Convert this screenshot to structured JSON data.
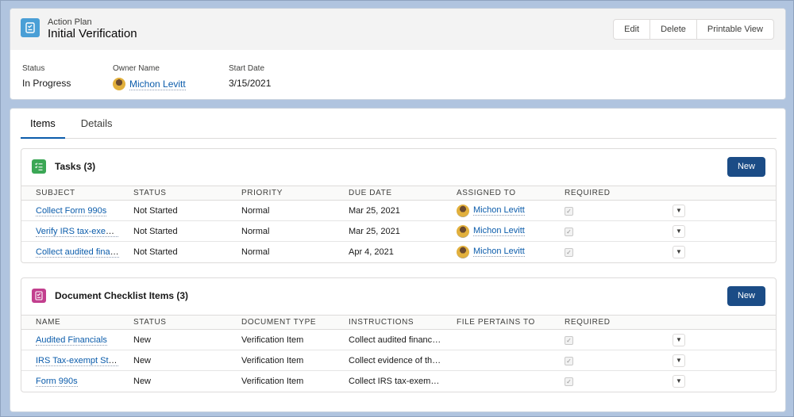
{
  "header": {
    "record_type": "Action Plan",
    "title": "Initial Verification",
    "icon": "action-plan-icon",
    "buttons": [
      "Edit",
      "Delete",
      "Printable View"
    ],
    "fields": {
      "status": {
        "label": "Status",
        "value": "In Progress"
      },
      "owner": {
        "label": "Owner Name",
        "value": "Michon Levitt"
      },
      "start_date": {
        "label": "Start Date",
        "value": "3/15/2021"
      }
    }
  },
  "tabs": [
    {
      "label": "Items",
      "active": true
    },
    {
      "label": "Details",
      "active": false
    }
  ],
  "tasks": {
    "title": "Tasks (3)",
    "new_label": "New",
    "icon_color": "#3ba755",
    "columns": [
      "SUBJECT",
      "STATUS",
      "PRIORITY",
      "DUE DATE",
      "ASSIGNED TO",
      "REQUIRED"
    ],
    "rows": [
      {
        "subject": "Collect Form 990s",
        "status": "Not Started",
        "priority": "Normal",
        "due": "Mar 25, 2021",
        "assigned": "Michon Levitt",
        "required": true
      },
      {
        "subject": "Verify IRS tax-exempt...",
        "status": "Not Started",
        "priority": "Normal",
        "due": "Mar 25, 2021",
        "assigned": "Michon Levitt",
        "required": true
      },
      {
        "subject": "Collect audited finan...",
        "status": "Not Started",
        "priority": "Normal",
        "due": "Apr 4, 2021",
        "assigned": "Michon Levitt",
        "required": true
      }
    ]
  },
  "documents": {
    "title": "Document Checklist Items (3)",
    "new_label": "New",
    "icon_color": "#c23f8e",
    "columns": [
      "NAME",
      "STATUS",
      "DOCUMENT TYPE",
      "INSTRUCTIONS",
      "FILE PERTAINS TO",
      "REQUIRED"
    ],
    "rows": [
      {
        "name": "Audited Financials",
        "status": "New",
        "type": "Verification Item",
        "instructions": "Collect audited financia...",
        "file": "",
        "required": true
      },
      {
        "name": "IRS Tax-exempt Status",
        "status": "New",
        "type": "Verification Item",
        "instructions": "Collect evidence of the ...",
        "file": "",
        "required": true
      },
      {
        "name": "Form 990s",
        "status": "New",
        "type": "Verification Item",
        "instructions": "Collect IRS tax-exempt r...",
        "file": "",
        "required": true
      }
    ]
  },
  "colors": {
    "brand_button": "#1b4c86",
    "link": "#0b5cab",
    "header_icon": "#4a9fd6"
  }
}
